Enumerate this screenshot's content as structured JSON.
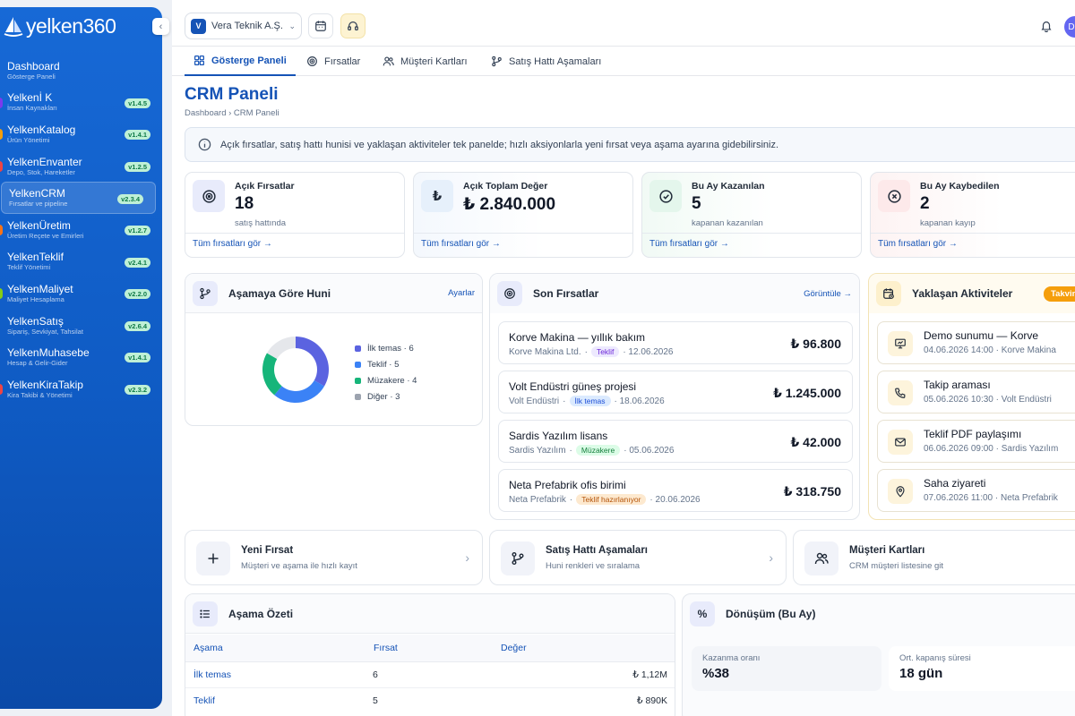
{
  "brand": {
    "logo_text": "yelken360",
    "collapse": "‹"
  },
  "sidebar": {
    "items": [
      {
        "label": "Dashboard",
        "sub": "Gösterge Paneli",
        "version": "",
        "dot": ""
      },
      {
        "label": "Yelkenİ K",
        "sub": "İnsan Kaynakları",
        "version": "v1.4.5",
        "dot": "#7c3aed"
      },
      {
        "label": "YelkenKatalog",
        "sub": "Ürün Yönetimi",
        "version": "v1.4.1",
        "dot": "#f59e0b"
      },
      {
        "label": "YelkenEnvanter",
        "sub": "Depo, Stok, Hareketler",
        "version": "v1.2.5",
        "dot": "#ef4444"
      },
      {
        "label": "YelkenCRM",
        "sub": "Fırsatlar ve pipeline",
        "version": "v2.3.4",
        "dot": ""
      },
      {
        "label": "YelkenÜretim",
        "sub": "Üretim Reçete ve Emirleri",
        "version": "v1.2.7",
        "dot": "#f97316"
      },
      {
        "label": "YelkenTeklif",
        "sub": "Teklif Yönetimi",
        "version": "v2.4.1",
        "dot": ""
      },
      {
        "label": "YelkenMaliyet",
        "sub": "Maliyet Hesaplama",
        "version": "v2.2.0",
        "dot": "#84cc16"
      },
      {
        "label": "YelkenSatış",
        "sub": "Sipariş, Sevkiyat, Tahsilat",
        "version": "v2.6.4",
        "dot": ""
      },
      {
        "label": "YelkenMuhasebe",
        "sub": "Hesap & Gelir-Gider",
        "version": "v1.4.1",
        "dot": ""
      },
      {
        "label": "YelkenKiraTakip",
        "sub": "Kira Takibi & Yönetimi",
        "version": "v2.3.2",
        "dot": "#ef4444"
      }
    ]
  },
  "topbar": {
    "company_initial": "V",
    "company": "Vera Teknik A.Ş.",
    "avatar_initial": "D"
  },
  "tabs": [
    {
      "label": "Gösterge Paneli",
      "icon": "grid-icon"
    },
    {
      "label": "Fırsatlar",
      "icon": "target-icon"
    },
    {
      "label": "Müşteri Kartları",
      "icon": "users-icon"
    },
    {
      "label": "Satış Hattı Aşamaları",
      "icon": "pipeline-icon"
    }
  ],
  "page": {
    "title": "CRM Paneli",
    "breadcrumb": "Dashboard › CRM Paneli",
    "info": "Açık fırsatlar, satış hattı hunisi ve yaklaşan aktiviteler tek panelde; hızlı aksiyonlarla yeni fırsat veya aşama ayarına gidebilirsiniz."
  },
  "kpis": [
    {
      "label": "Açık Fırsatlar",
      "value": "18",
      "sub": "satış hattında",
      "link": "Tüm fırsatları gör →",
      "color": "#e8ebfb"
    },
    {
      "label": "Açık Toplam Değer",
      "value": "₺ 2.840.000",
      "sub": "",
      "link": "Tüm fırsatları gör →",
      "color": "#e6f0fb"
    },
    {
      "label": "Bu Ay Kazanılan",
      "value": "5",
      "sub": "kapanan kazanılan",
      "link": "Tüm fırsatları gör →",
      "color": "#e4f6ec"
    },
    {
      "label": "Bu Ay Kaybedilen",
      "value": "2",
      "sub": "kapanan kayıp",
      "link": "Tüm fırsatları gör →",
      "color": "#fde9ea"
    }
  ],
  "funnel": {
    "title": "Aşamaya Göre Huni",
    "link": "Ayarlar",
    "segments": [
      {
        "label": "İlk temas · 6",
        "value": 6,
        "color": "#5b63e0"
      },
      {
        "label": "Teklif · 5",
        "value": 5,
        "color": "#3b82f6"
      },
      {
        "label": "Müzakere · 4",
        "value": 4,
        "color": "#16b57a"
      },
      {
        "label": "Diğer · 3",
        "value": 3,
        "color": "#e5e7eb"
      }
    ]
  },
  "recent": {
    "title": "Son Fırsatlar",
    "link": "Görüntüle →",
    "items": [
      {
        "title": "Korve Makina — yıllık bakım",
        "company": "Korve Makina Ltd.",
        "tag": "Teklif",
        "tag_bg": "#ede9fe",
        "tag_fg": "#6d28d9",
        "date": "· 12.06.2026",
        "amount": "₺ 96.800"
      },
      {
        "title": "Volt Endüstri güneş projesi",
        "company": "Volt Endüstri",
        "tag": "İlk temas",
        "tag_bg": "#dbeafe",
        "tag_fg": "#1d4ed8",
        "date": "· 18.06.2026",
        "amount": "₺ 1.245.000"
      },
      {
        "title": "Sardis Yazılım lisans",
        "company": "Sardis Yazılım",
        "tag": "Müzakere",
        "tag_bg": "#dcfce7",
        "tag_fg": "#15803d",
        "date": "· 05.06.2026",
        "amount": "₺ 42.000"
      },
      {
        "title": "Neta Prefabrik ofis birimi",
        "company": "Neta Prefabrik",
        "tag": "Teklif hazırlanıyor",
        "tag_bg": "#fde9cf",
        "tag_fg": "#b45309",
        "date": "· 20.06.2026",
        "amount": "₺ 318.750"
      }
    ]
  },
  "activities": {
    "title": "Yaklaşan Aktiviteler",
    "badge": "Takvim",
    "items": [
      {
        "title": "Demo sunumu — Korve",
        "meta": "04.06.2026 14:00 · Korve Makina",
        "icon": "presentation-icon"
      },
      {
        "title": "Takip araması",
        "meta": "05.06.2026 10:30 · Volt Endüstri",
        "icon": "phone-icon"
      },
      {
        "title": "Teklif PDF paylaşımı",
        "meta": "06.06.2026 09:00 · Sardis Yazılım",
        "icon": "mail-icon"
      },
      {
        "title": "Saha ziyareti",
        "meta": "07.06.2026 11:00 · Neta Prefabrik",
        "icon": "map-pin-icon"
      }
    ]
  },
  "quick": [
    {
      "title": "Yeni Fırsat",
      "sub": "Müşteri ve aşama ile hızlı kayıt",
      "icon": "plus-icon"
    },
    {
      "title": "Satış Hattı Aşamaları",
      "sub": "Huni renkleri ve sıralama",
      "icon": "pipeline-icon"
    },
    {
      "title": "Müşteri Kartları",
      "sub": "CRM müşteri listesine git",
      "icon": "users-icon"
    }
  ],
  "summary": {
    "title": "Aşama Özeti",
    "columns": [
      "Aşama",
      "Fırsat",
      "Değer"
    ],
    "rows": [
      {
        "stage": "İlk temas",
        "count": "6",
        "value": "₺ 1,12M"
      },
      {
        "stage": "Teklif",
        "count": "5",
        "value": "₺ 890K"
      }
    ]
  },
  "conversion": {
    "title": "Dönüşüm (Bu Ay)",
    "stats": [
      {
        "label": "Kazanma oranı",
        "value": "%38"
      },
      {
        "label": "Ort. kapanış süresi",
        "value": "18 gün"
      }
    ]
  }
}
